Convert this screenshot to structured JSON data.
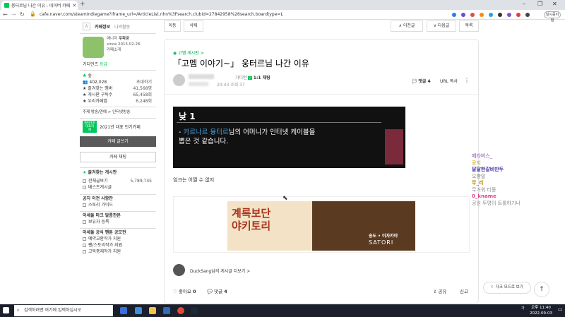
{
  "browser": {
    "tab_title": "웅터르님 나간 이유 : 네이버 카페",
    "url": "cafe.naver.com/steamindiegame?iframe_url=/ArticleList.nhn%3Fsearch.clubid=27842958%26search.boardtype=L",
    "profile_label": "일시중지됨",
    "ext_colors": [
      "#2b7de9",
      "#6a4cd6",
      "#e24b4b",
      "#ff8a00",
      "#1da1f2",
      "#333333",
      "#7d57c2",
      "#e43e3e",
      "#444444"
    ]
  },
  "sidebar": {
    "tab_info": "카페정보",
    "tab_my": "나의활동",
    "manager_label": "매니저",
    "manager": "우왁굳",
    "since": "since 2015.02.26.",
    "intro": "카페소개",
    "rank_label": "가디언즈",
    "rank_value": "등급",
    "grade": "숲",
    "members": "402,028",
    "invite": "초대하기",
    "stats": [
      {
        "label": "즐겨찾는 멤버",
        "value": "41,568명"
      },
      {
        "label": "게시판 구독수",
        "value": "65,458회"
      },
      {
        "label": "우리카페앱",
        "value": "6,248회"
      }
    ],
    "tags": "주제 방송/연예 > 인터넷방송",
    "naver_badge": "NAVER 대표카페",
    "award": "2021년 대표 인기카페",
    "write_btn": "카페 글쓰기",
    "chat_btn": "카페 채팅",
    "fav_boards_title": "즐겨찾는 게시판",
    "fav_boards": [
      {
        "label": "전체글보기",
        "count": "5,789,745"
      },
      {
        "label": "베스트게시글",
        "count": ""
      }
    ],
    "sec1_title": "공지 이전 사항판",
    "sec1_items": [
      "스토리 가이드"
    ],
    "sec2_title": "이세돌 마크 발롱판본",
    "sec2_items": [
      "보유자 등록"
    ],
    "sec3_title": "이세돌 공식 팬툰 공모전",
    "sec3_items": [
      "예약교환작가 지원",
      "팬/스토리작가 지원",
      "고독중재작가 지원"
    ]
  },
  "toolbar": {
    "move": "이동",
    "delete": "삭제",
    "prev": "∧ 이전글",
    "next": "∨ 다음글",
    "list": "목록"
  },
  "article": {
    "board": "고멤 게시판",
    "title": "「고멤 이야기~」 웅터르님 나간 이유",
    "author_rank": "가디언",
    "chat_label": "1:1 채팅",
    "date": "20:43",
    "views": "조회 37",
    "comment_label": "댓글 4",
    "url_copy": "URL 복사",
    "img_day": "낮 1",
    "img_text_pre": "- ",
    "img_name": "카르나르 융터르",
    "img_text_post": "님의 어머니가 인터넷 케이블을",
    "img_text_line2": "뽑은 것 같습니다.",
    "body": "엄크는 어쩔 수 없지",
    "ad_big1": "계륵보단",
    "ad_big2": "야키토리",
    "ad_brand": "송도 • 이자카야",
    "ad_brand2": "SATORI",
    "author_link": "DuckSang님의 게시글 더보기 >",
    "like_label": "좋아요",
    "like_count": "0",
    "comment_label2": "댓글",
    "comment_count": "4",
    "share": "공유",
    "report": "신고",
    "dark_mode": "다크 모드로 보기"
  },
  "chat_overlay": [
    {
      "text": "메타버스_",
      "color": "#b07fd4"
    },
    {
      "text": "공지",
      "color": "#c79a00"
    },
    {
      "text": "달달한갈비만두",
      "color": "#3a2ea3"
    },
    {
      "text": "오빵말",
      "color": "#888888"
    },
    {
      "text": "무_리",
      "color": "#b58900"
    },
    {
      "text": "무거워 티똥",
      "color": "#888888"
    },
    {
      "text": "0_kname",
      "color": "#e04090"
    },
    {
      "text": "공원 두명이 트롤하기나",
      "color": "#888888"
    }
  ],
  "taskbar": {
    "search": "검색하려면 여기에 입력하십시오",
    "time": "오후 11:40",
    "date": "2022-09-03",
    "lang": "가"
  }
}
